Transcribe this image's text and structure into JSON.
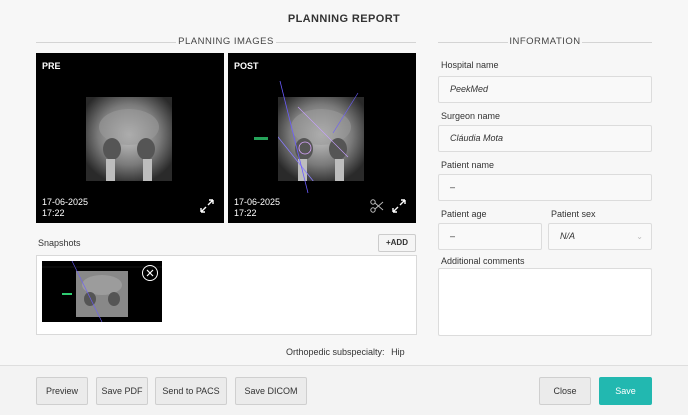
{
  "header": {
    "title": "PLANNING REPORT"
  },
  "planning_images": {
    "heading": "PLANNING IMAGES",
    "pre": {
      "label": "PRE",
      "date": "17-06-2025",
      "time": "17:22"
    },
    "post": {
      "label": "POST",
      "date": "17-06-2025",
      "time": "17:22"
    }
  },
  "snapshots": {
    "label": "Snapshots",
    "add_label": "+ADD"
  },
  "subspecialty": {
    "label": "Orthopedic subspecialty:",
    "value": "Hip"
  },
  "information": {
    "heading": "INFORMATION",
    "hospital": {
      "label": "Hospital name",
      "value": "PeekMed"
    },
    "surgeon": {
      "label": "Surgeon name",
      "value": "Cláudia Mota"
    },
    "patient": {
      "label": "Patient name",
      "value": "–"
    },
    "age": {
      "label": "Patient age",
      "value": "–"
    },
    "sex": {
      "label": "Patient sex",
      "value": "N/A"
    },
    "comments": {
      "label": "Additional comments"
    }
  },
  "footer": {
    "preview": "Preview",
    "save_pdf": "Save PDF",
    "send_pacs": "Send to PACS",
    "save_dicom": "Save DICOM",
    "close": "Close",
    "save": "Save"
  },
  "colors": {
    "accent": "#22b8b0",
    "image_bg": "#000000"
  }
}
